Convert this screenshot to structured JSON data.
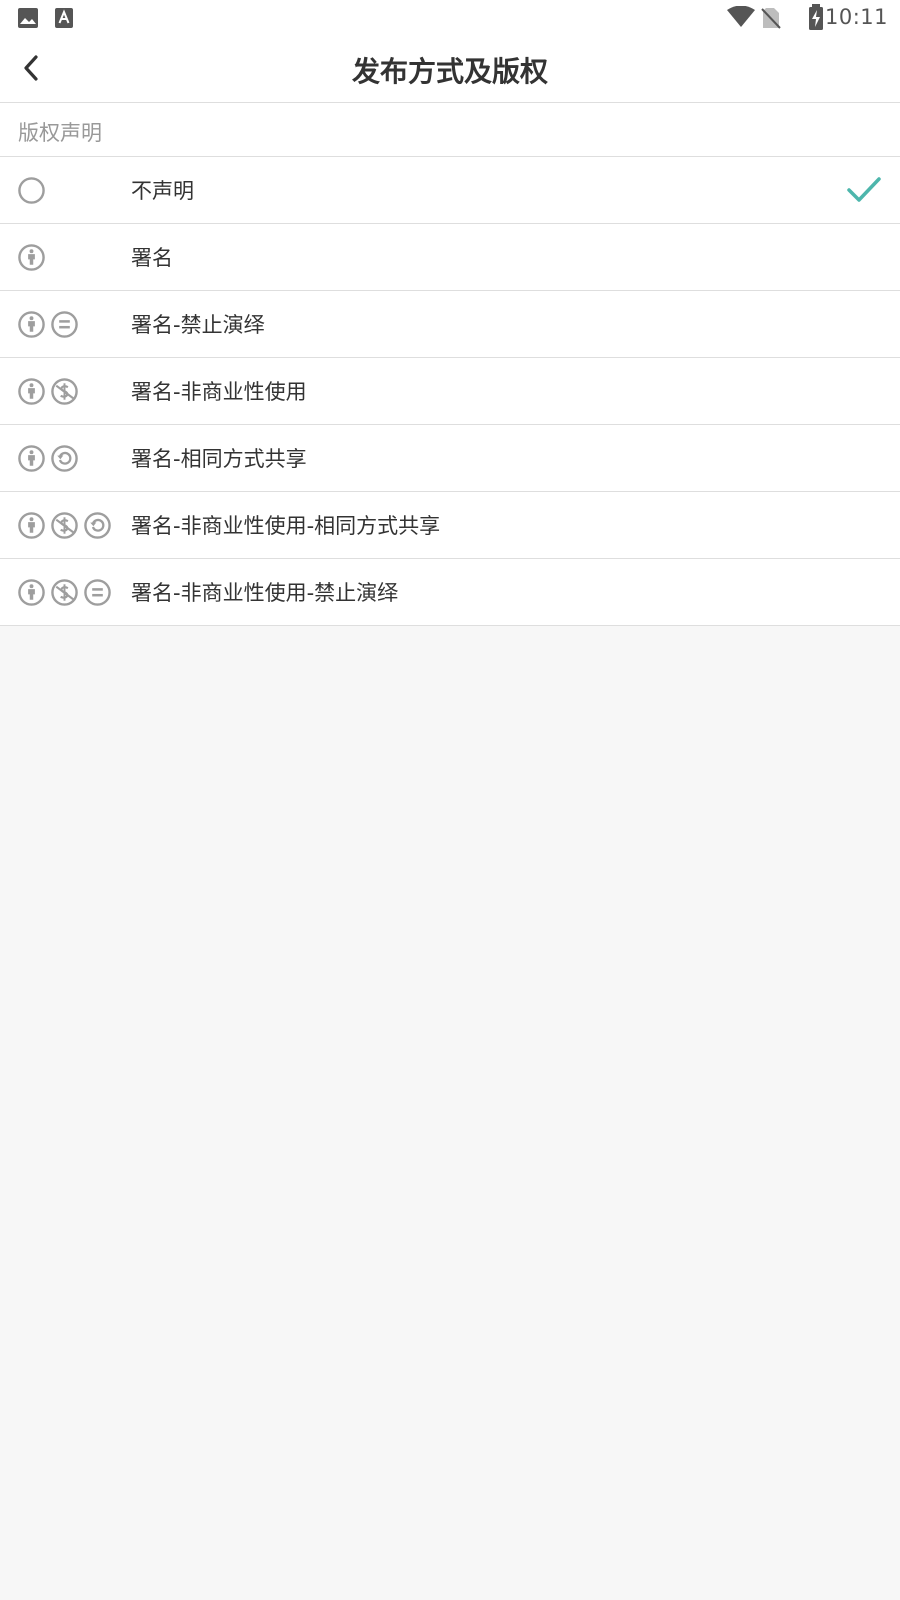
{
  "status_bar": {
    "time": "10:11",
    "left_icons": [
      "image-icon",
      "font-download-icon"
    ],
    "right_icons": [
      "wifi-icon",
      "no-sim-icon",
      "battery-charging-icon"
    ]
  },
  "header": {
    "title": "发布方式及版权",
    "back_icon": "chevron-left-icon"
  },
  "section": {
    "title": "版权声明"
  },
  "licenses": [
    {
      "label": "不声明",
      "icons": [
        "none"
      ],
      "selected": true
    },
    {
      "label": "署名",
      "icons": [
        "by"
      ],
      "selected": false
    },
    {
      "label": "署名-禁止演绎",
      "icons": [
        "by",
        "nd"
      ],
      "selected": false
    },
    {
      "label": "署名-非商业性使用",
      "icons": [
        "by",
        "nc"
      ],
      "selected": false
    },
    {
      "label": "署名-相同方式共享",
      "icons": [
        "by",
        "sa"
      ],
      "selected": false
    },
    {
      "label": "署名-非商业性使用-相同方式共享",
      "icons": [
        "by",
        "nc",
        "sa"
      ],
      "selected": false
    },
    {
      "label": "署名-非商业性使用-禁止演绎",
      "icons": [
        "by",
        "nc",
        "nd"
      ],
      "selected": false
    }
  ],
  "colors": {
    "accent": "#4db6ac",
    "icon_gray": "#9e9e9e",
    "divider": "#dedede",
    "background": "#f7f7f7",
    "text_primary": "#333333",
    "text_secondary": "#999999"
  }
}
